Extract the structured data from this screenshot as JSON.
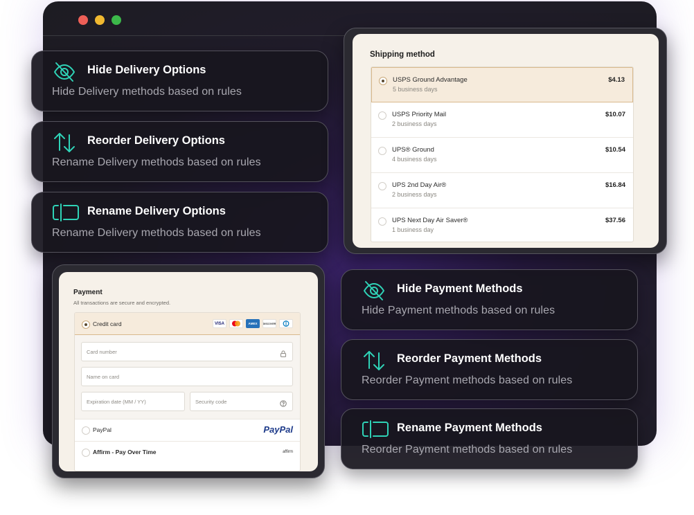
{
  "window": {
    "controls": [
      "close",
      "minimize",
      "maximize"
    ]
  },
  "features": [
    {
      "icon": "eye-off-icon",
      "title": "Hide Delivery Options",
      "desc": "Hide Delivery methods based on rules"
    },
    {
      "icon": "sort-arrows-icon",
      "title": "Reorder Delivery Options",
      "desc": "Rename Delivery methods based on rules"
    },
    {
      "icon": "rename-field-icon",
      "title": "Rename Delivery Options",
      "desc": "Rename Delivery methods based on rules"
    },
    {
      "icon": "eye-off-icon",
      "title": "Hide Payment Methods",
      "desc": "Hide Payment methods based on rules"
    },
    {
      "icon": "sort-arrows-icon",
      "title": "Reorder Payment Methods",
      "desc": "Reorder Payment methods based on rules"
    },
    {
      "icon": "rename-field-icon",
      "title": "Rename Payment Methods",
      "desc": "Reorder Payment methods based on rules"
    }
  ],
  "shipping": {
    "title": "Shipping method",
    "options": [
      {
        "name": "USPS Ground Advantage",
        "days": "5 business days",
        "price": "$4.13",
        "selected": true
      },
      {
        "name": "USPS Priority Mail",
        "days": "2 business days",
        "price": "$10.07",
        "selected": false
      },
      {
        "name": "UPS® Ground",
        "days": "4 business days",
        "price": "$10.54",
        "selected": false
      },
      {
        "name": "UPS 2nd Day Air®",
        "days": "2 business days",
        "price": "$16.84",
        "selected": false
      },
      {
        "name": "UPS Next Day Air Saver®",
        "days": "1 business day",
        "price": "$37.56",
        "selected": false
      }
    ]
  },
  "payment": {
    "title": "Payment",
    "subtitle": "All transactions are secure and encrypted.",
    "credit_card_label": "Credit card",
    "brands": [
      "VISA",
      "mastercard",
      "AMEX",
      "DISCOVER",
      "diners"
    ],
    "card_number_placeholder": "Card number",
    "name_on_card_placeholder": "Name on card",
    "expiration_placeholder": "Expiration date (MM / YY)",
    "security_code_placeholder": "Security code",
    "paypal_label": "PayPal",
    "paypal_logo_text": "PayPal",
    "affirm_label": "Affirm - Pay Over Time",
    "affirm_logo_text": "affirm"
  },
  "colors": {
    "accent_teal": "#2fd3b7",
    "selected_row_bg": "#f6ebdc",
    "window_bg": "#201c2a"
  }
}
